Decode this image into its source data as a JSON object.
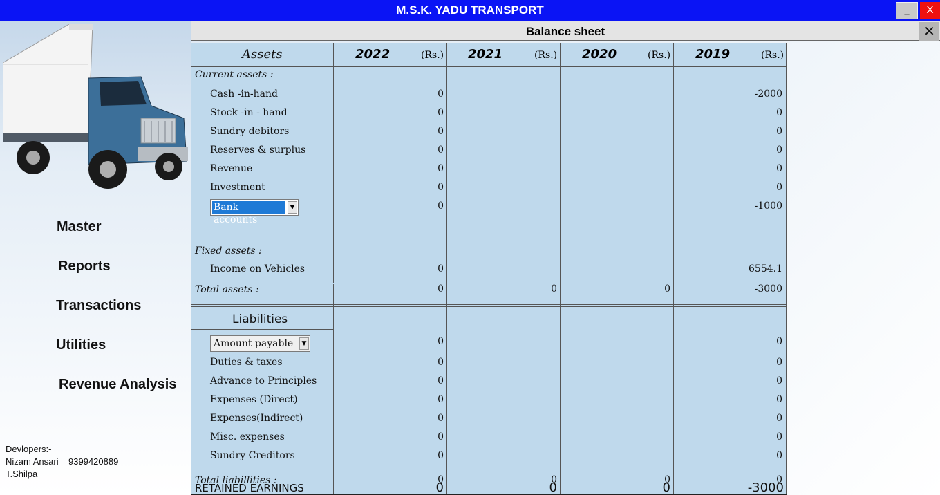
{
  "window": {
    "title": "M.S.K. YADU TRANSPORT",
    "minimize_label": "_",
    "close_label": "X"
  },
  "sidebar": {
    "nav": [
      "Master",
      "Reports",
      "Transactions",
      "Utilities",
      "Revenue Analysis"
    ],
    "developers": [
      "Devlopers:-",
      "Nizam Ansari    9399420889",
      "T.Shilpa"
    ]
  },
  "panel": {
    "title": "Balance sheet",
    "close_label": "✕"
  },
  "columns": {
    "label_header": "Assets",
    "years": [
      "2022",
      "2021",
      "2020",
      "2019"
    ],
    "currency": "(Rs.)"
  },
  "assets": {
    "current_heading": "Current assets :",
    "current_rows": [
      {
        "label": "Cash -in-hand",
        "values": [
          "0",
          "",
          "",
          "-2000"
        ]
      },
      {
        "label": "Stock -in - hand",
        "values": [
          "0",
          "",
          "",
          "0"
        ]
      },
      {
        "label": "Sundry debitors",
        "values": [
          "0",
          "",
          "",
          "0"
        ]
      },
      {
        "label": "Reserves & surplus",
        "values": [
          "0",
          "",
          "",
          "0"
        ]
      },
      {
        "label": "Revenue",
        "values": [
          "0",
          "",
          "",
          "0"
        ]
      },
      {
        "label": "Investment",
        "values": [
          "0",
          "",
          "",
          "0"
        ]
      }
    ],
    "bank_combo": {
      "selected": "Bank accounts",
      "values": [
        "0",
        "",
        "",
        "-1000"
      ]
    },
    "fixed_heading": "Fixed assets :",
    "fixed_rows": [
      {
        "label": "Income on Vehicles",
        "values": [
          "0",
          "",
          "",
          "6554.1"
        ]
      }
    ],
    "total_label": "Total assets :",
    "total_values": [
      "0",
      "0",
      "0",
      "-3000"
    ]
  },
  "liabilities": {
    "heading": "Liabilities",
    "combo": {
      "selected": "Amount payable",
      "values": [
        "0",
        "",
        "",
        "0"
      ]
    },
    "rows": [
      {
        "label": "Duties & taxes",
        "values": [
          "0",
          "",
          "",
          "0"
        ]
      },
      {
        "label": "Advance to Principles",
        "values": [
          "0",
          "",
          "",
          "0"
        ]
      },
      {
        "label": "Expenses (Direct)",
        "values": [
          "0",
          "",
          "",
          "0"
        ]
      },
      {
        "label": "Expenses(Indirect)",
        "values": [
          "0",
          "",
          "",
          "0"
        ]
      },
      {
        "label": "Misc. expenses",
        "values": [
          "0",
          "",
          "",
          "0"
        ]
      },
      {
        "label": "Sundry Creditors",
        "values": [
          "0",
          "",
          "",
          "0"
        ]
      }
    ],
    "total_label": "Total liabillities :",
    "total_values": [
      "0",
      "0",
      "0",
      "0"
    ]
  },
  "retained": {
    "label": "RETAINED EARNINGS",
    "values": [
      "0",
      "0",
      "0",
      "-3000"
    ]
  },
  "colors": {
    "titlebar": "#0a14f5",
    "sheet": "#bfd9ec",
    "selection": "#1e7ad6",
    "close": "#ee1111"
  }
}
